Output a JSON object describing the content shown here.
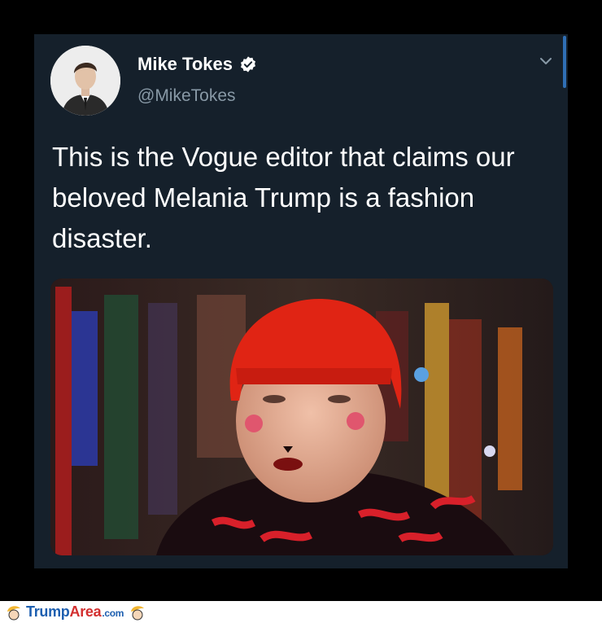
{
  "tweet": {
    "display_name": "Mike Tokes",
    "handle": "@MikeTokes",
    "verified": true,
    "text": "This is the Vogue editor that claims our beloved Melania Trump is a fashion disaster.",
    "icons": {
      "verified": "verified-badge-icon",
      "menu": "chevron-down-icon"
    }
  },
  "footer": {
    "logo_part1": "Trump",
    "logo_part2": "Area",
    "logo_part3": ".com"
  },
  "colors": {
    "background": "#000000",
    "card": "#15202b",
    "handle": "#8899a6",
    "logo_blue": "#1d5fb0",
    "logo_red": "#d32f2f"
  }
}
